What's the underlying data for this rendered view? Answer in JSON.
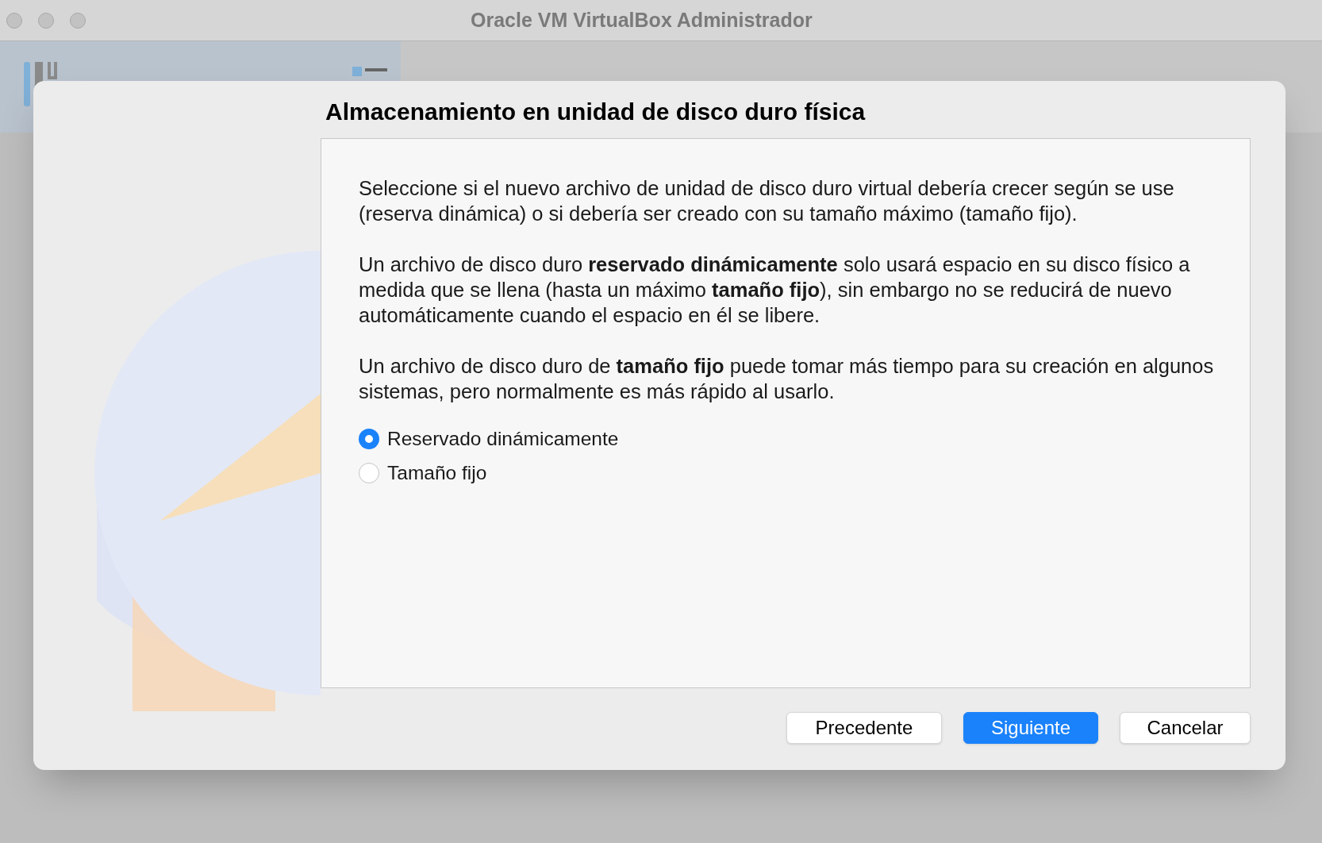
{
  "window": {
    "title": "Oracle VM VirtualBox Administrador"
  },
  "dialog": {
    "title": "Almacenamiento en unidad de disco duro física",
    "paragraphs": [
      "Seleccione si el nuevo archivo de unidad de disco duro virtual debería crecer según se use (reserva dinámica) o si debería ser creado con su tamaño máximo (tamaño fijo).",
      "Un archivo de disco duro **reservado dinámicamente** solo usará espacio en su disco físico a medida que se llena (hasta un máximo **tamaño fijo**), sin embargo no se reducirá de nuevo automáticamente cuando el espacio en él se libere.",
      "Un archivo de disco duro de **tamaño fijo** puede tomar más tiempo para su creación en algunos sistemas, pero normalmente es más rápido al usarlo."
    ],
    "options": [
      {
        "label": "Reservado dinámicamente",
        "selected": true
      },
      {
        "label": "Tamaño fijo",
        "selected": false
      }
    ],
    "buttons": [
      {
        "label": "Precedente",
        "kind": "secondary"
      },
      {
        "label": "Siguiente",
        "kind": "primary"
      },
      {
        "label": "Cancelar",
        "kind": "secondary"
      }
    ]
  }
}
